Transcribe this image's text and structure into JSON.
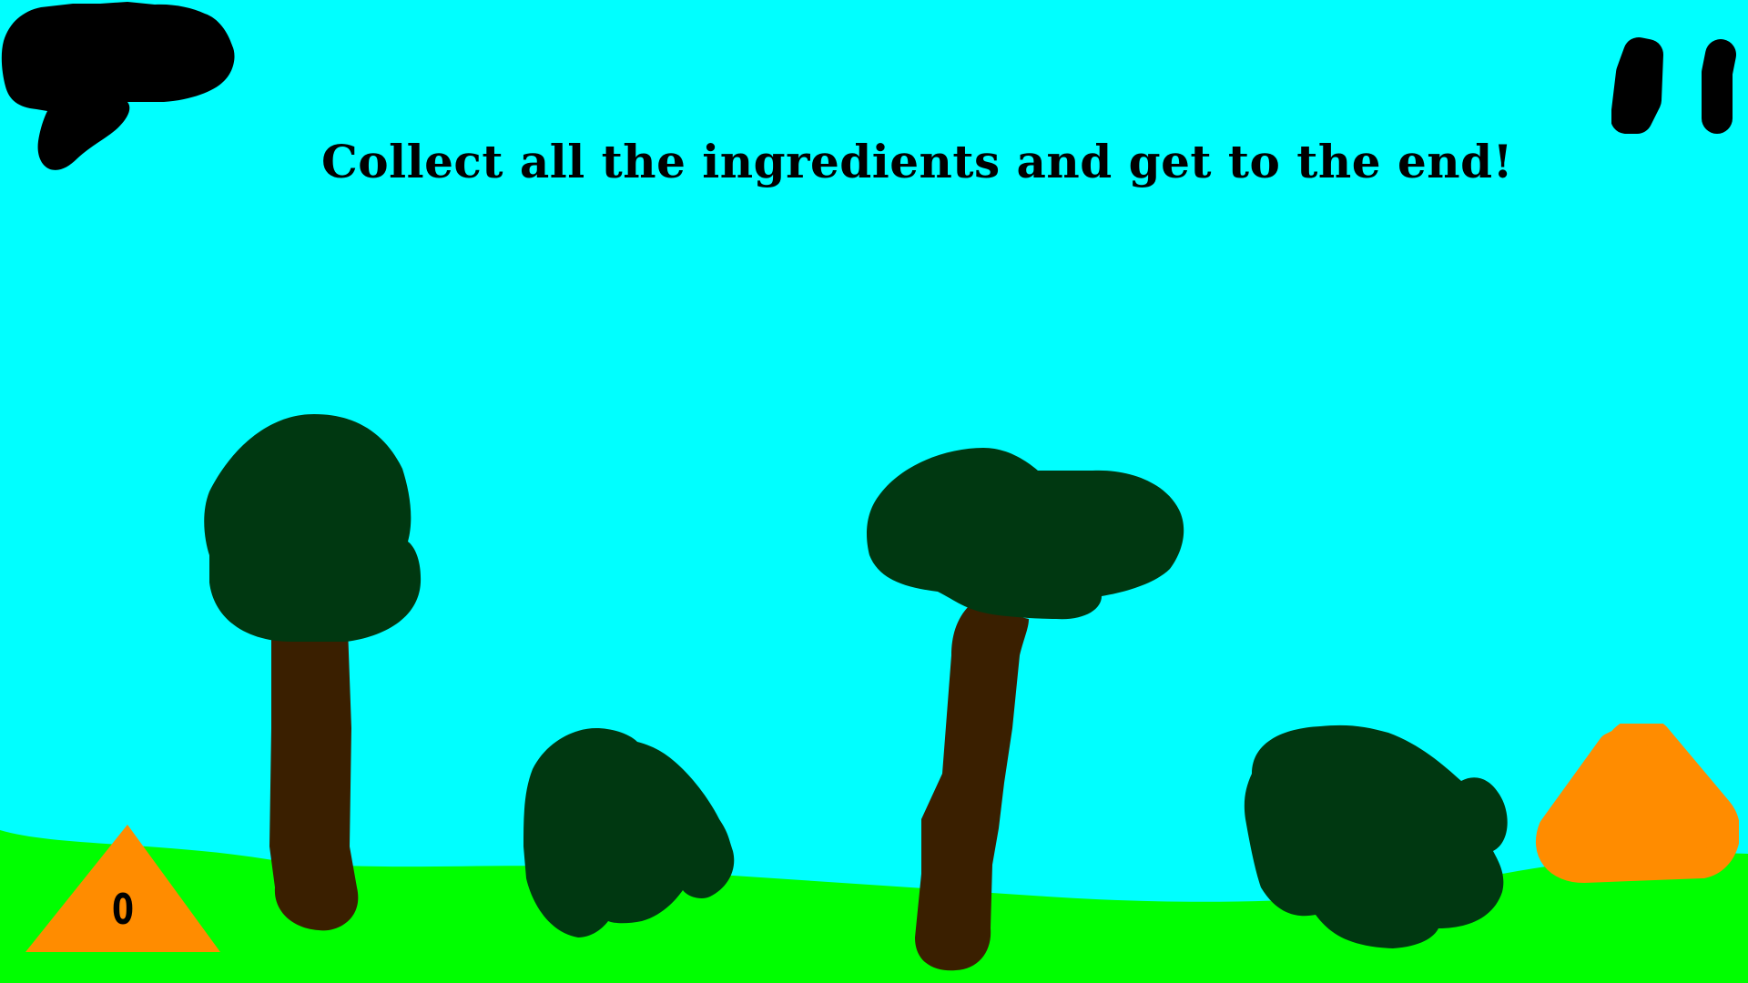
{
  "game": {
    "instruction": "Collect all the ingredients and get to the end!",
    "ingredient_count": "0"
  },
  "colors": {
    "sky": "#00ffff",
    "grass": "#00ff00",
    "foliage": "#003811",
    "trunk": "#3a1f00",
    "button_orange": "#ff8c00",
    "ink": "#000000"
  },
  "icons": {
    "back": "back-arrow-icon",
    "pause": "pause-icon",
    "jump": "jump-triangle-icon"
  }
}
